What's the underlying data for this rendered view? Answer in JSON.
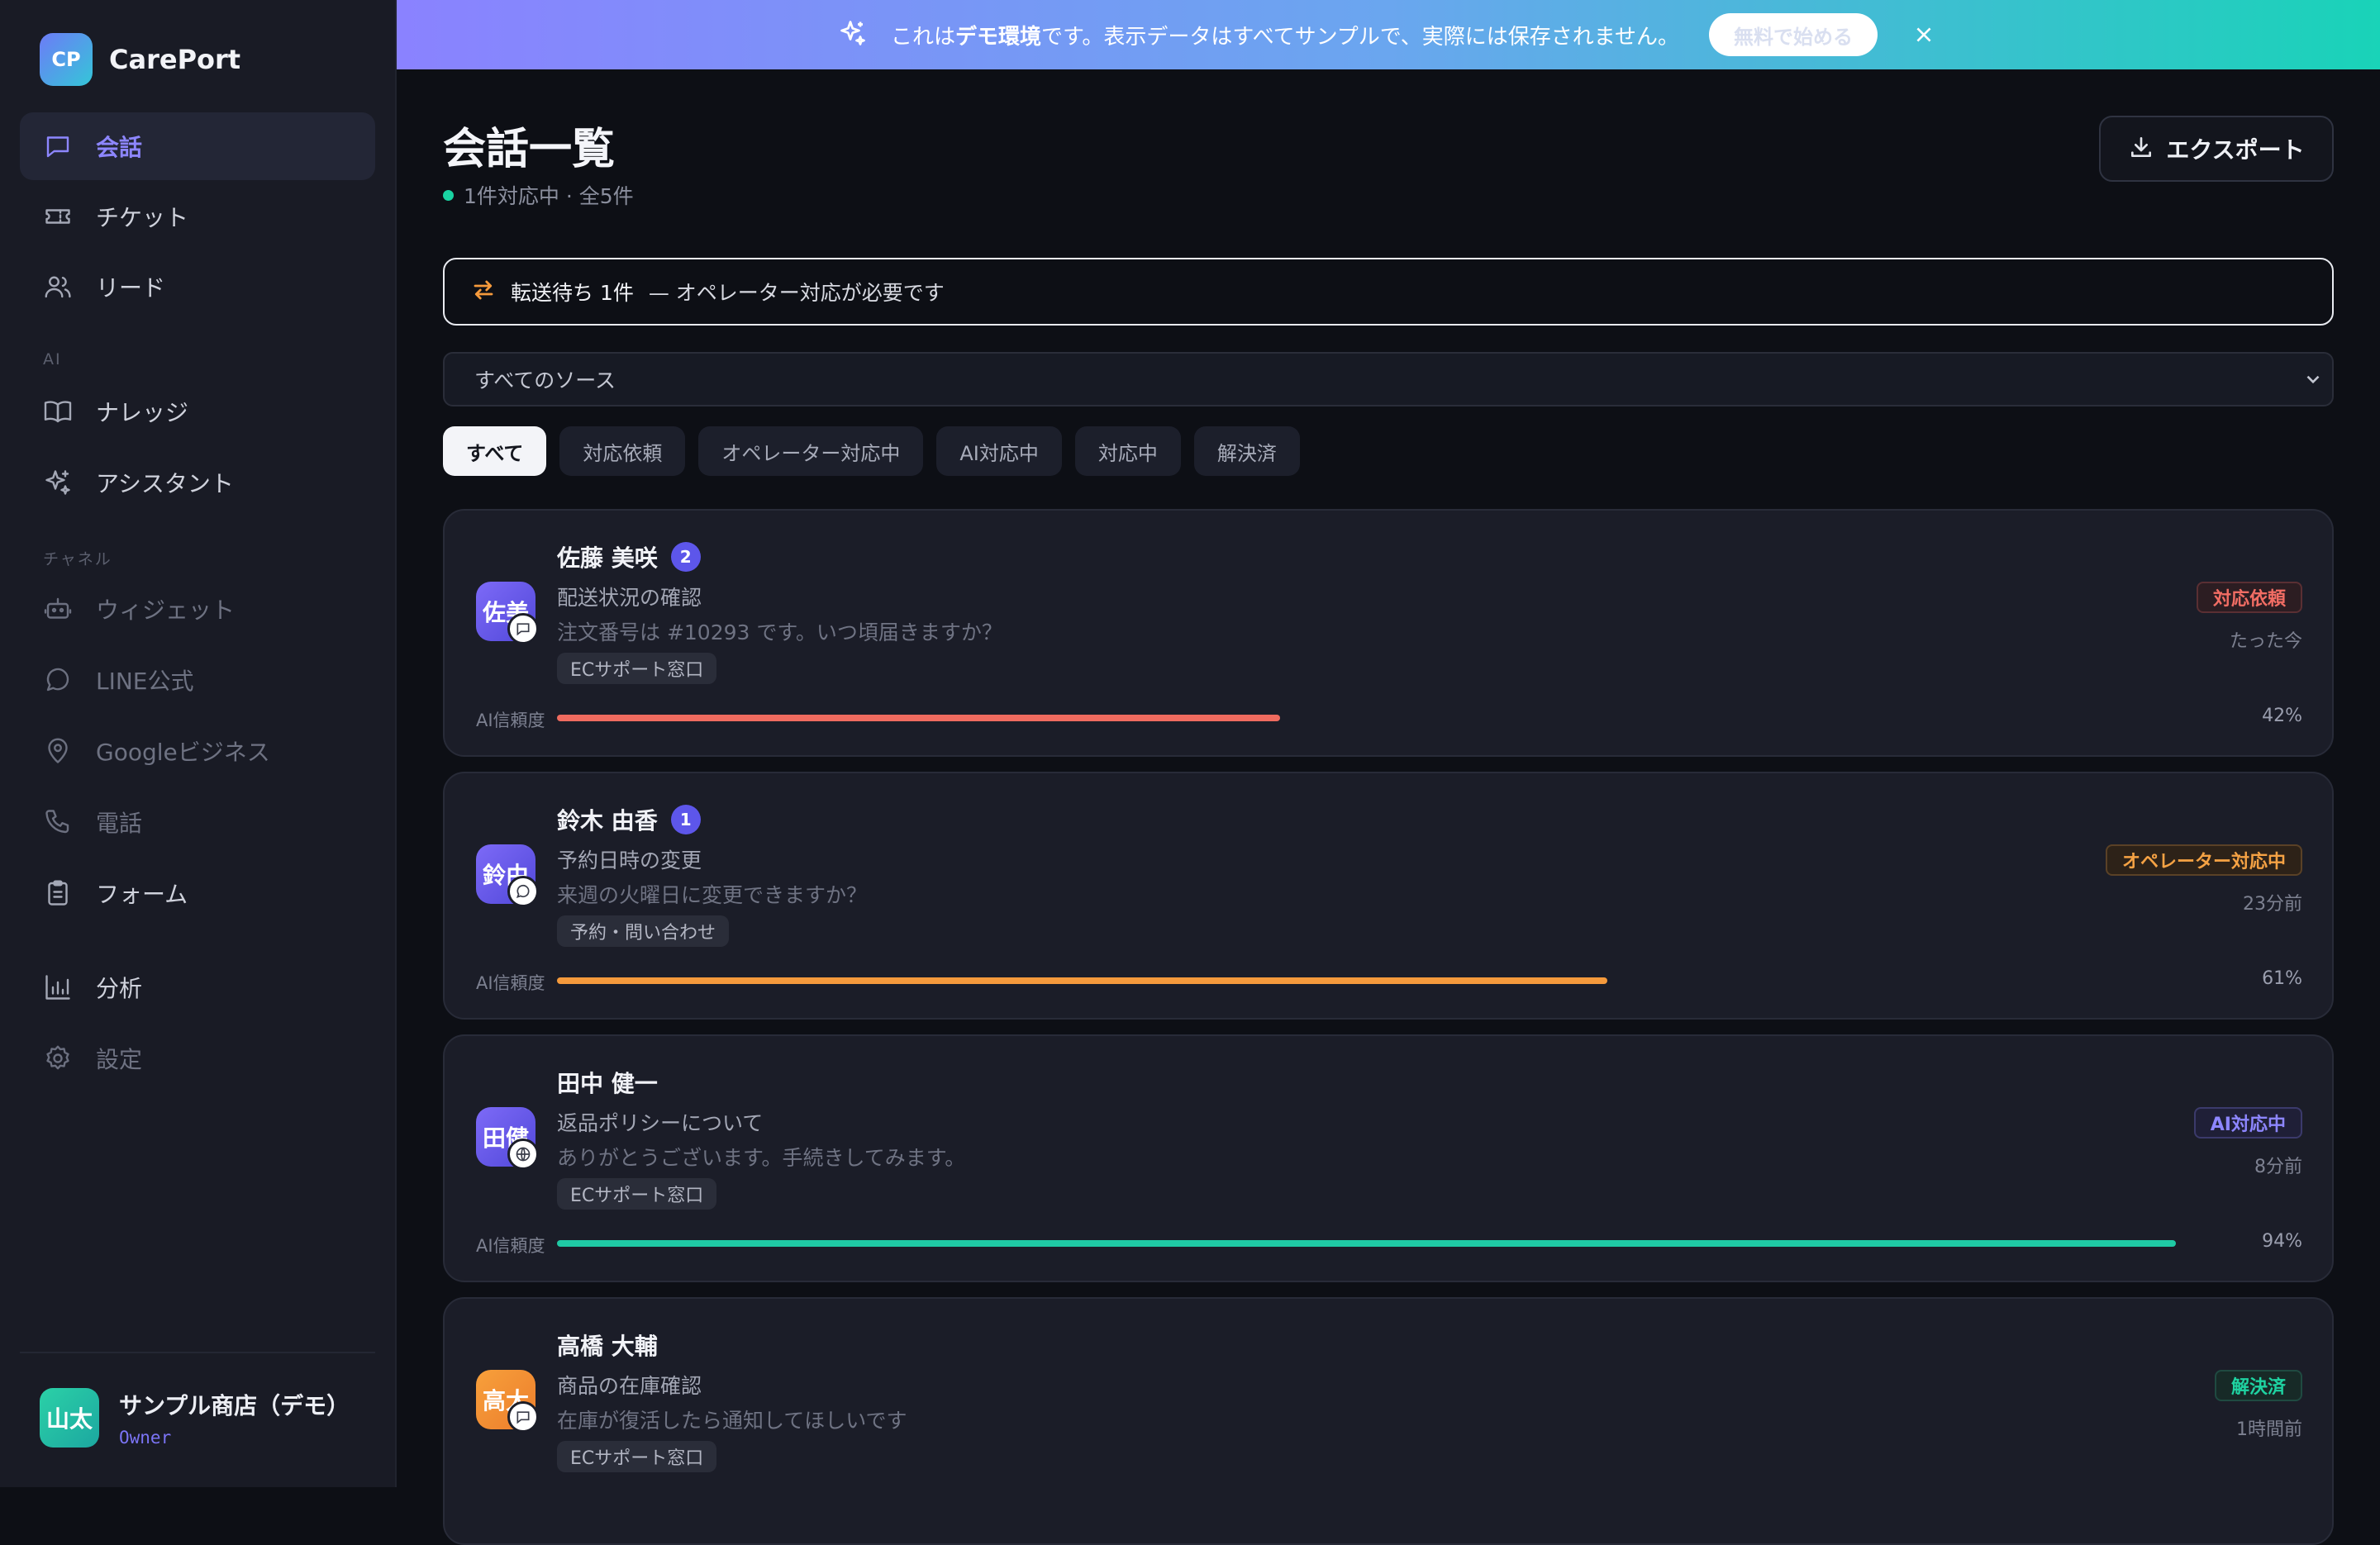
{
  "brand": {
    "logo_text": "CP",
    "name": "CarePort"
  },
  "sidebar": {
    "items": [
      {
        "label": "会話",
        "icon": "chat-icon"
      },
      {
        "label": "チケット",
        "icon": "ticket-icon"
      },
      {
        "label": "リード",
        "icon": "users-icon"
      },
      {
        "label": "ナレッジ",
        "icon": "book-icon"
      },
      {
        "label": "アシスタント",
        "icon": "sparkles-icon"
      },
      {
        "label": "ウィジェット",
        "icon": "bot-icon"
      },
      {
        "label": "LINE公式",
        "icon": "message-circle-icon"
      },
      {
        "label": "Googleビジネス",
        "icon": "map-pin-icon"
      },
      {
        "label": "電話",
        "icon": "phone-icon"
      },
      {
        "label": "フォーム",
        "icon": "clipboard-icon"
      },
      {
        "label": "分析",
        "icon": "bar-chart-icon"
      },
      {
        "label": "設定",
        "icon": "gear-icon"
      }
    ],
    "sections": {
      "ai": "AI",
      "channels": "チャネル"
    },
    "user": {
      "avatar": "山太",
      "name": "サンプル商店（デモ）",
      "role": "Owner"
    }
  },
  "banner": {
    "prefix": "これは",
    "bold": "デモ環境",
    "suffix": "です。表示データはすべてサンプルで、実際には保存されません。",
    "button": "無料で始める"
  },
  "header": {
    "title": "会話一覧",
    "subtitle": "1件対応中 · 全5件",
    "export_label": "エクスポート"
  },
  "transfer": {
    "count": "転送待ち 1件",
    "note": "— オペレーター対応が必要です"
  },
  "source_filter": {
    "selected": "すべてのソース"
  },
  "tabs": [
    "すべて",
    "対応依頼",
    "オペレーター対応中",
    "AI対応中",
    "対応中",
    "解決済"
  ],
  "confidence_label": "AI信頼度",
  "conversations": [
    {
      "avatar": "佐美",
      "name": "佐藤 美咲",
      "unread": "2",
      "subject": "配送状況の確認",
      "preview": "注文番号は #10293 です。いつ頃届きますか？",
      "tag": "ECサポート窓口",
      "status": "対応依頼",
      "time": "たった今",
      "confidence": 0.42,
      "confidence_text": "42%",
      "bar_color": "#ef6b5f",
      "channel": "chat-square-icon"
    },
    {
      "avatar": "鈴由",
      "name": "鈴木 由香",
      "unread": "1",
      "subject": "予約日時の変更",
      "preview": "来週の火曜日に変更できますか？",
      "tag": "予約・問い合わせ",
      "status": "オペレーター対応中",
      "time": "23分前",
      "confidence": 0.61,
      "confidence_text": "61%",
      "bar_color": "#f59a3c",
      "channel": "message-circle-icon"
    },
    {
      "avatar": "田健",
      "name": "田中 健一",
      "unread": "",
      "subject": "返品ポリシーについて",
      "preview": "ありがとうございます。手続きしてみます。",
      "tag": "ECサポート窓口",
      "status": "AI対応中",
      "time": "8分前",
      "confidence": 0.94,
      "confidence_text": "94%",
      "bar_color": "#1fc9a4",
      "channel": "globe-icon"
    },
    {
      "avatar": "高大",
      "name": "高橋 大輔",
      "unread": "",
      "subject": "商品の在庫確認",
      "preview": "在庫が復活したら通知してほしいです",
      "tag": "ECサポート窓口",
      "status": "解決済",
      "time": "1時間前",
      "channel": "chat-square-icon"
    }
  ]
}
